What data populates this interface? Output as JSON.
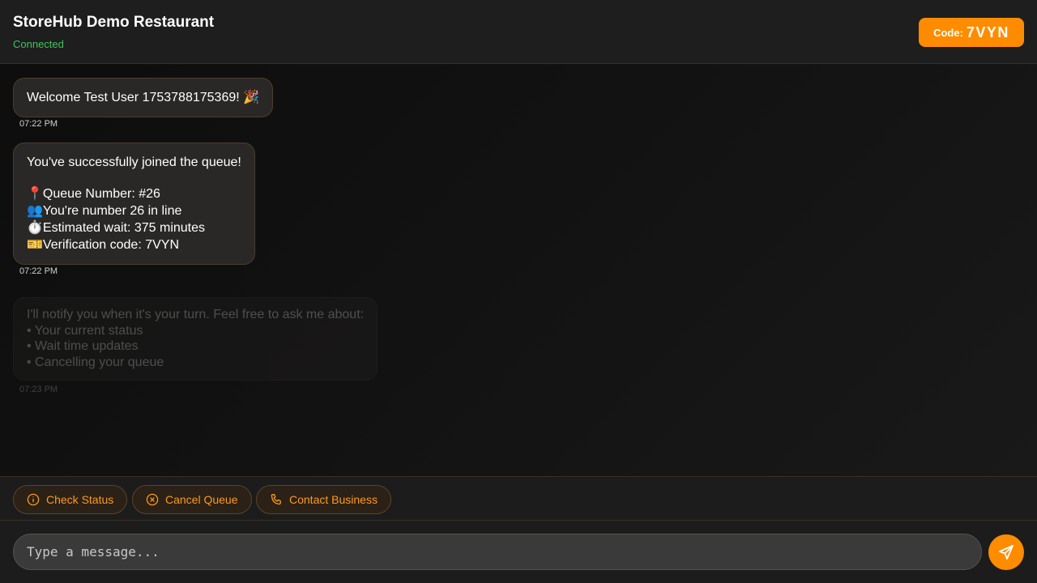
{
  "header": {
    "title": "StoreHub Demo Restaurant",
    "status": "Connected",
    "code_label": "Code:",
    "code_value": "7VYN"
  },
  "messages": [
    {
      "lines": [
        "Welcome Test User 1753788175369! 🎉"
      ],
      "time": "07:22 PM"
    },
    {
      "intro": "You've successfully joined the queue!",
      "lines": [
        "📍Queue Number: #26",
        "👥You're number 26 in line",
        "⏱️Estimated wait: 375 minutes",
        "🎫Verification code: 7VYN"
      ],
      "time": "07:22 PM"
    },
    {
      "lines": [
        "I'll notify you when it's your turn. Feel free to ask me about:",
        "• Your current status",
        "• Wait time updates",
        "• Cancelling your queue"
      ],
      "time": "07:23 PM"
    }
  ],
  "quick_actions": [
    {
      "label": "Check Status",
      "icon": "info-icon"
    },
    {
      "label": "Cancel Queue",
      "icon": "cancel-circle-icon"
    },
    {
      "label": "Contact Business",
      "icon": "phone-icon"
    }
  ],
  "composer": {
    "placeholder": "Type a message...",
    "send_icon": "send-icon"
  },
  "colors": {
    "accent": "#ff8c00",
    "connected": "#3ec45a",
    "chip_text": "#ff9a1a"
  }
}
